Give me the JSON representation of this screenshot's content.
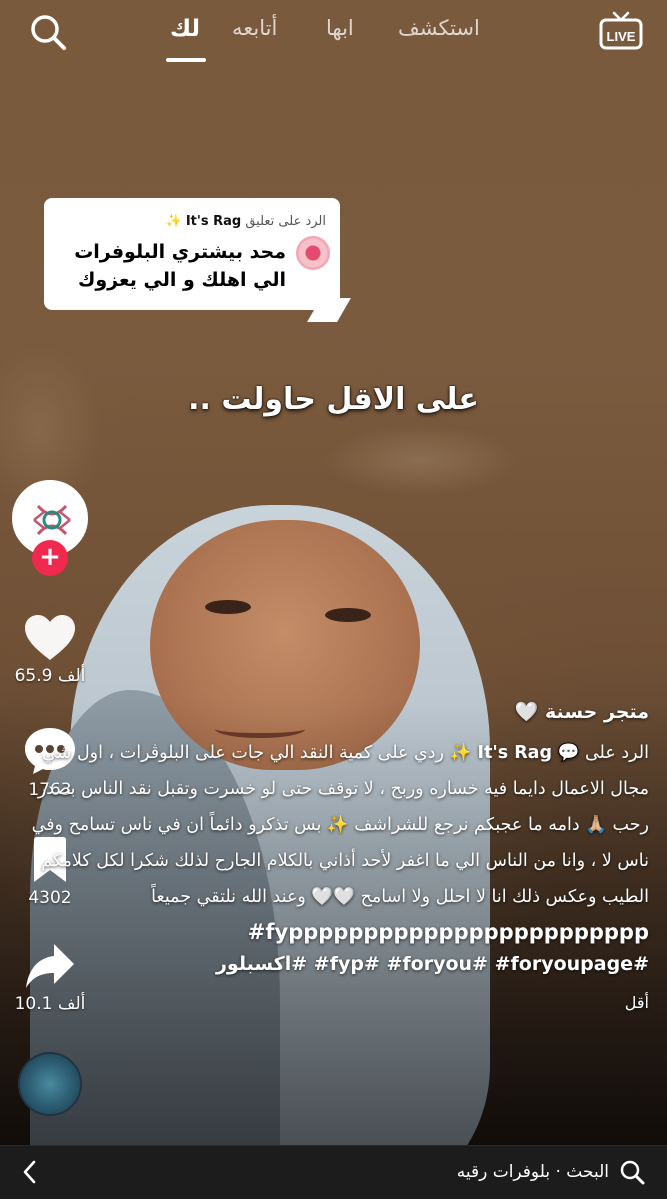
{
  "top_nav": {
    "tabs": [
      {
        "label": "استكشف"
      },
      {
        "label": "ابها"
      },
      {
        "label": "أتابعه"
      },
      {
        "label": "لك"
      }
    ],
    "live_label": "LIVE"
  },
  "reply_card": {
    "prefix": "الرد على تعليق",
    "username": "It's Rag",
    "sparkle": "✨",
    "text": "محد بيشتري البلوفرات الي اهلك و الي يعزوك"
  },
  "overlay_caption": "على الاقل حاولت ..",
  "actions": {
    "likes": "65.9 ألف",
    "comments": "1763",
    "saves": "4302",
    "shares": "10.1 ألف"
  },
  "description": {
    "shop_name": "متجر حسنة 🤍",
    "reply_prefix": "الرد على 💬",
    "reply_user": "It's Rag ✨",
    "body": "ردي على كمية النقد الي جات على البلوڤرات ، اول شي مجال الاعمال دايما فيه خساره وربح ، لا توقف حتى لو خسرت وتقبل نقد الناس بصدر رحب 🙏🏼 دامه ما عجبكم نرجع للشراشف ✨ بس تذكرو دائماً ان في ناس تسامح وفي ناس لا ، وانا من الناس الي ما اغفر لأحد أذاني بالكلام الجارح لذلك شكرا لكل كلامكم الطيب وعكس ذلك انا لا احلل ولا اسامح 🤍🤍 وعند الله نلتقي جميعاً",
    "tags_line1": "#fypppppppppppppppppppppppp",
    "tags_line2": "اكسبلور# #fyp# #foryou# #foryoupage#",
    "less_label": "أقل"
  },
  "bottom_bar": {
    "search_text": "البحث · بلوفرات رقيه"
  }
}
